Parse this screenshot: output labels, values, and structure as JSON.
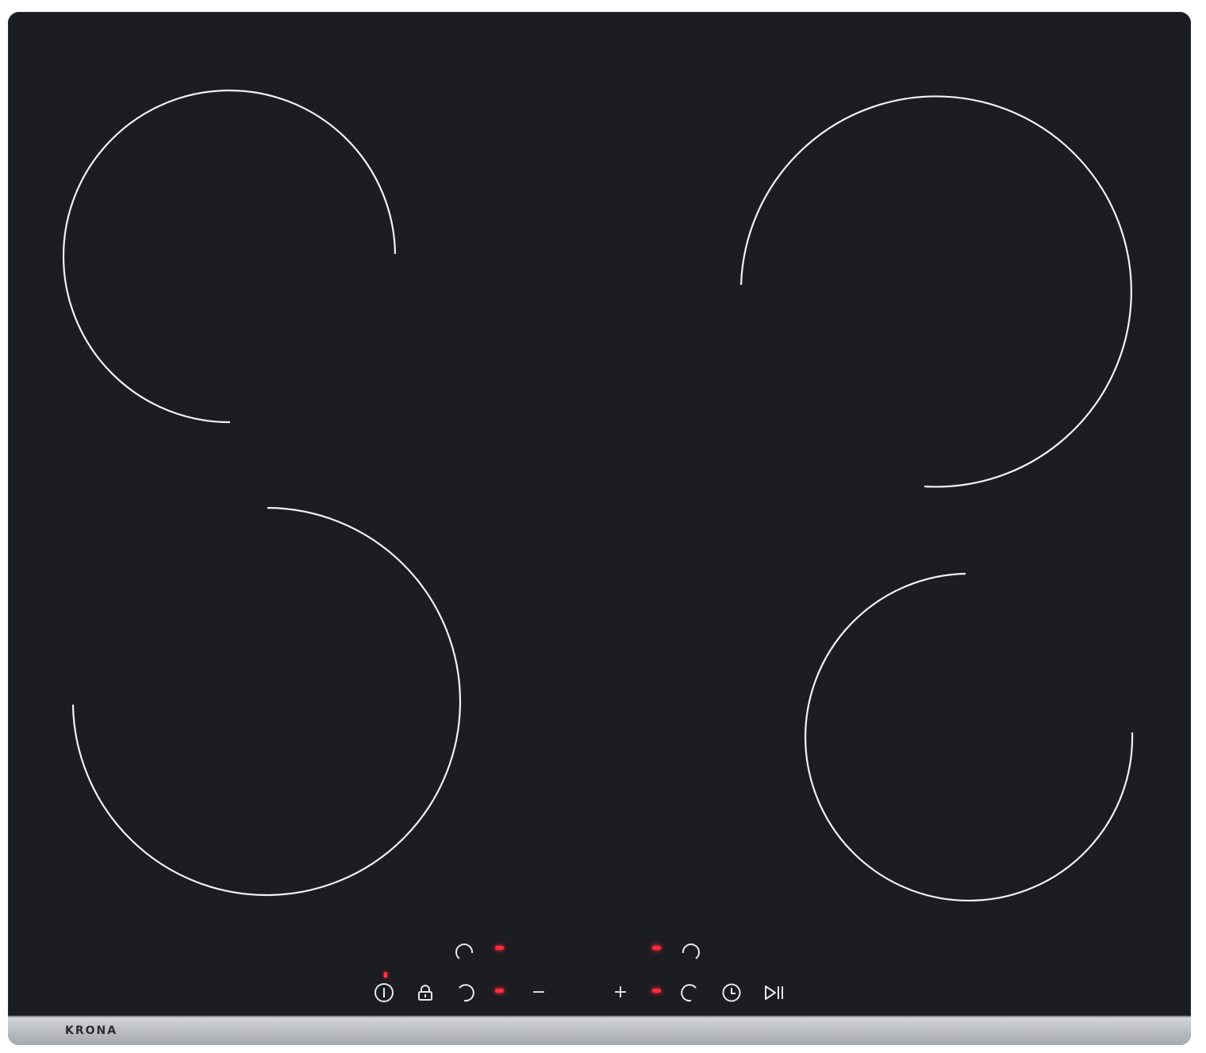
{
  "brand": {
    "text": "KRONA"
  },
  "colors": {
    "glass": "#1c1d21",
    "zone_outline": "#f2f2f2",
    "indicator_led": "#ff2a3c",
    "trim": "#b7babf"
  },
  "controls": {
    "minus_symbol": "−",
    "plus_symbol": "+",
    "icons": [
      "power-icon",
      "lock-icon",
      "zone-selector-icon",
      "timer-icon",
      "play-pause-icon"
    ]
  }
}
